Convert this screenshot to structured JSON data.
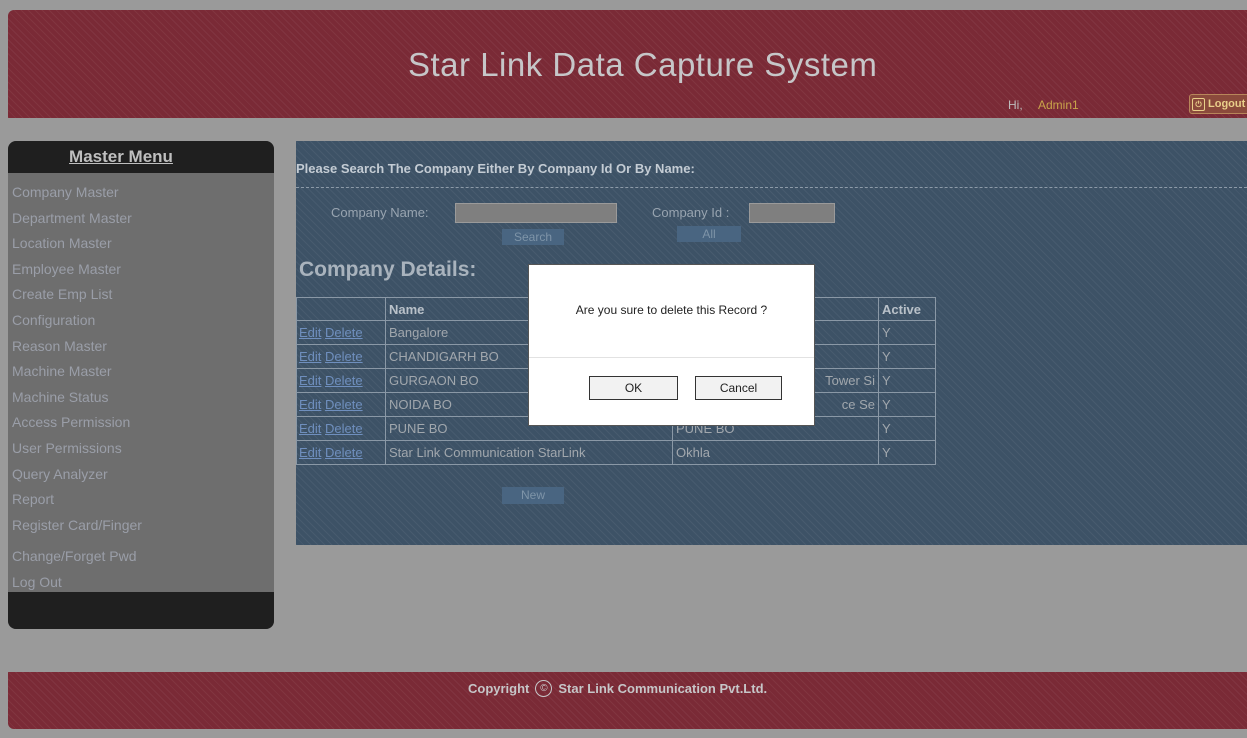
{
  "header": {
    "title": "Star Link Data Capture System",
    "greeting": "Hi,",
    "username": "Admin1",
    "logout_label": "Logout"
  },
  "sidebar": {
    "heading": "Master Menu",
    "items": [
      {
        "label": "Company Master"
      },
      {
        "label": "Department Master"
      },
      {
        "label": "Location Master"
      },
      {
        "label": "Employee Master"
      },
      {
        "label": "Create Emp List"
      },
      {
        "label": "Configuration"
      },
      {
        "label": "Reason Master"
      },
      {
        "label": "Machine Master"
      },
      {
        "label": "Machine Status"
      },
      {
        "label": "Access Permission"
      },
      {
        "label": "User Permissions"
      },
      {
        "label": "Query Analyzer"
      },
      {
        "label": "Report"
      },
      {
        "label": "Register Card/Finger"
      },
      {
        "label": "Change/Forget Pwd"
      },
      {
        "label": "Log Out"
      }
    ]
  },
  "search": {
    "prompt": "Please Search The Company Either By Company Id Or By Name:",
    "company_name_label": "Company Name:",
    "company_name_value": "",
    "company_id_label": "Company Id :",
    "company_id_value": "",
    "search_button": "Search",
    "all_button": "All"
  },
  "details": {
    "heading": "Company Details:",
    "columns": [
      "",
      "Name",
      "",
      "Active"
    ],
    "edit_label": "Edit",
    "delete_label": "Delete",
    "rows": [
      {
        "name": "Bangalore",
        "location": "",
        "active": "Y"
      },
      {
        "name": "CHANDIGARH BO",
        "location": "",
        "active": "Y"
      },
      {
        "name": "GURGAON BO",
        "location": "Tower Si",
        "active": "Y"
      },
      {
        "name": "NOIDA BO",
        "location": "ce Se",
        "active": "Y"
      },
      {
        "name": "PUNE BO",
        "location": "PUNE BO",
        "active": "Y"
      },
      {
        "name": "Star Link Communication  StarLink",
        "location": "Okhla",
        "active": "Y"
      }
    ],
    "new_button": "New"
  },
  "dialog": {
    "message": "Are you sure to delete this Record ?",
    "ok_label": "OK",
    "cancel_label": "Cancel"
  },
  "footer": {
    "copyright_label": "Copyright",
    "copyright_symbol": "©",
    "company": "Star Link Communication Pvt.Ltd."
  },
  "colors": {
    "header_bg": "#7a2a36",
    "main_bg": "#3d5266",
    "sidebar_bg": "#6e6e6e",
    "link": "#6f8fbe",
    "username": "#c9a44a"
  }
}
